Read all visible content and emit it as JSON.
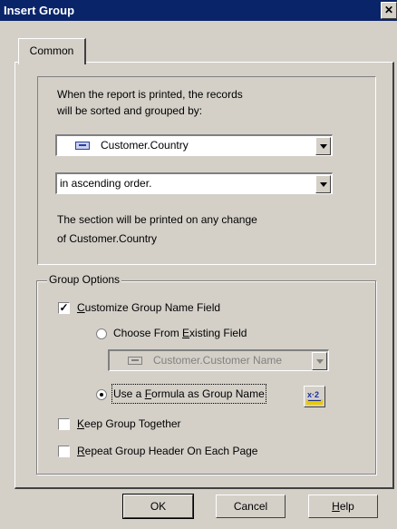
{
  "window": {
    "title": "Insert Group",
    "close_label": "✕"
  },
  "tabs": [
    {
      "label": "Common"
    }
  ],
  "sort": {
    "description_line1": "When the report is printed, the records",
    "description_line2": "will be sorted and grouped by:",
    "field": "Customer.Country",
    "order": "in ascending order.",
    "section_line1": "The section will be printed on any change",
    "section_line2": "of  Customer.Country"
  },
  "group_options": {
    "legend": "Group Options",
    "customize": {
      "label_u": "C",
      "label_rest": "ustomize Group Name Field",
      "checked": true
    },
    "choose_existing": {
      "label_pre": "Choose From ",
      "label_u": "E",
      "label_rest": "xisting Field",
      "selected": false
    },
    "existing_field": "Customer.Customer Name",
    "use_formula": {
      "label_pre": "Use a ",
      "label_u": "F",
      "label_rest": "ormula as Group Name",
      "selected": true
    },
    "keep_together": {
      "label_u": "K",
      "label_rest": "eep Group Together",
      "checked": false
    },
    "repeat_header": {
      "label_u": "R",
      "label_rest": "epeat Group Header On Each Page",
      "checked": false
    }
  },
  "buttons": {
    "ok": "OK",
    "cancel": "Cancel",
    "help_u": "H",
    "help_rest": "elp"
  },
  "colors": {
    "titlebar": "#0a246a",
    "face": "#d4d0c8"
  }
}
